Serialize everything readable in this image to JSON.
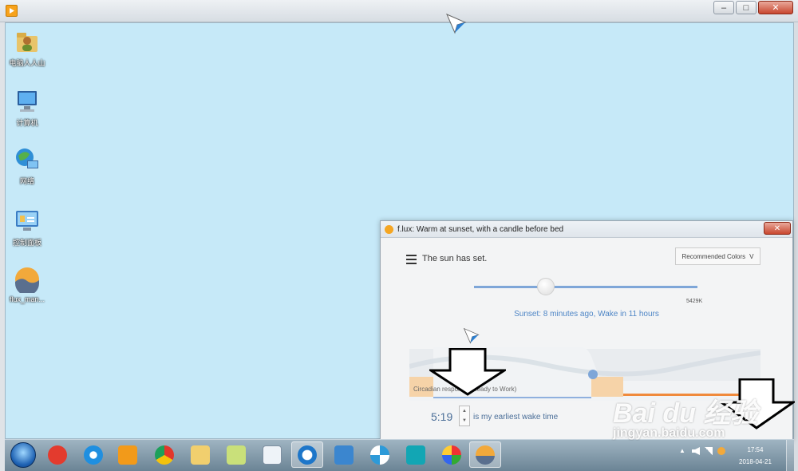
{
  "desktop_icons": [
    {
      "label": "电脑人人山",
      "icon": "user-folder-icon"
    },
    {
      "label": "计算机",
      "icon": "computer-icon"
    },
    {
      "label": "网络",
      "icon": "network-icon"
    },
    {
      "label": "控制面板",
      "icon": "control-panel-icon"
    },
    {
      "label": "flux_man...",
      "icon": "flux-app-icon"
    }
  ],
  "flux": {
    "title": "f.lux: Warm at sunset, with a candle before bed",
    "status": "The sun has set.",
    "colors_dropdown": "Recommended Colors",
    "kelvin": "5429K",
    "sunset_info": "Sunset: 8 minutes ago, Wake in 11 hours",
    "circadian_label": "Circadian response (Ready to Work)",
    "wake_time": "5:19",
    "wake_text": "is my earliest wake time",
    "close_glyph": "✕",
    "slider_level": 0.32
  },
  "window_controls": {
    "minimize": "‒",
    "maximize": "□",
    "close": "✕"
  },
  "taskbar": {
    "items": [
      "start-orb",
      "jiang-app-icon",
      "internet-explorer-icon",
      "media-player-icon",
      "chrome-icon",
      "file-explorer-icon",
      "sticky-notes-icon",
      "notepad-icon",
      "flux-active-icon",
      "remote-desktop-icon",
      "pinwheel-icon",
      "headset-icon",
      "paint-icon",
      "flux-taskbar-icon"
    ],
    "clock_time": "17:54",
    "clock_date": "2018-04-21"
  },
  "watermark": {
    "main": "Bai du 经验",
    "url": "jingyan.baidu.com"
  },
  "colors": {
    "desktop": "#c6e9f8",
    "accent": "#4f86c6",
    "orange": "#f08a3c"
  }
}
